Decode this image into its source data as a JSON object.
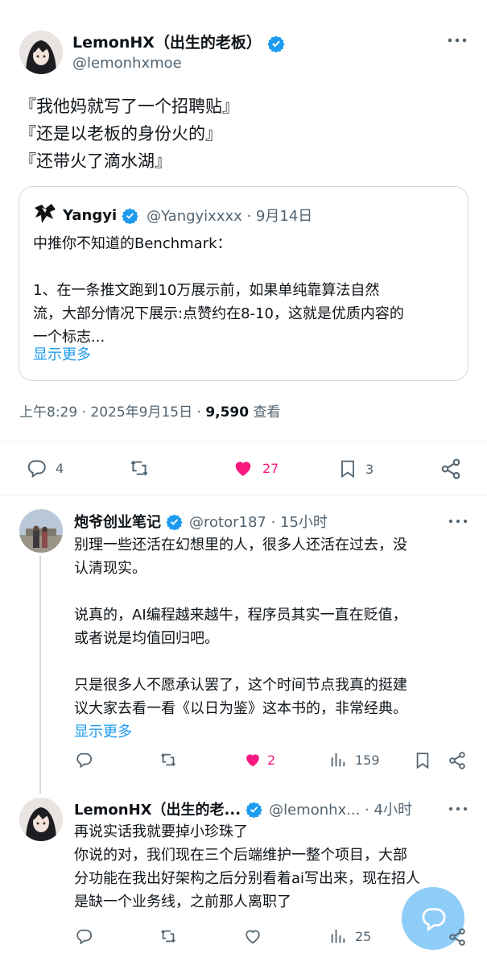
{
  "main_tweet": {
    "author_name": "LemonHX（出生的老板）",
    "handle": "@lemonhxmoe",
    "lines": [
      "『我他妈就写了一个招聘贴』",
      "『还是以老板的身份火的』",
      "『还带火了滴水湖』"
    ],
    "quote": {
      "author_name": "Yangyi",
      "meta": "@Yangyixxxx · 9月14日",
      "lines": [
        "中推你不知道的Benchmark：",
        "",
        "1、在一条推文跑到10万展示前，如果单纯靠算法自然",
        "流，大部分情况下展示:点赞约在8-10，这就是优质内容的",
        "一个标志..."
      ],
      "show_more": "显示更多"
    },
    "timestamp": "上午8:29 · 2025年9月15日 · ",
    "views_count": "9,590",
    "views_label": " 查看",
    "stats": {
      "replies": "4",
      "retweets": "",
      "likes": "27",
      "bookmarks": "3"
    }
  },
  "replies": [
    {
      "author_name": "炮爷创业笔记",
      "meta": "@rotor187 · 15小时",
      "lines": [
        "别理一些还活在幻想里的人，很多人还活在过去，没",
        "认清现实。",
        "",
        "说真的，AI编程越来越牛，程序员其实一直在贬值，",
        "或者说是均值回归吧。",
        "",
        "只是很多人不愿承认罢了，这个时间节点我真的挺建",
        "议大家去看一看《以日为鉴》这本书的，非常经典。"
      ],
      "show_more": "显示更多",
      "stats": {
        "replies": "",
        "retweets": "",
        "likes": "2",
        "views": "159"
      }
    },
    {
      "author_name": "LemonHX（出生的老...",
      "meta": "@lemonhx... · 4小时",
      "lines": [
        "再说实话我就要掉小珍珠了",
        "你说的对，我们现在三个后端维护一整个项目，大部",
        "分功能在我出好架构之后分别看着ai写出来，现在招人",
        "是缺一个业务线，之前那人离职了"
      ],
      "stats": {
        "replies": "",
        "retweets": "",
        "likes": "",
        "views": "25"
      }
    }
  ],
  "colors": {
    "accent": "#1d9bf0",
    "like": "#f91880",
    "muted": "#536471",
    "fab": "#8ecdf8"
  }
}
